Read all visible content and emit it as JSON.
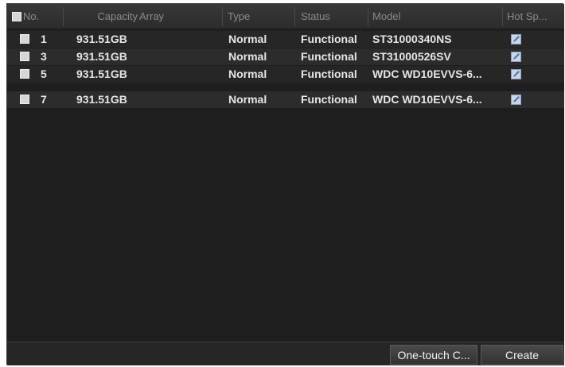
{
  "table": {
    "columns": {
      "no": "No.",
      "capacity": "Capacity",
      "array": "Array",
      "type": "Type",
      "status": "Status",
      "model": "Model",
      "hot_spare": "Hot Sp..."
    },
    "rows": [
      {
        "no": "1",
        "capacity": "931.51GB",
        "array": "",
        "type": "Normal",
        "status": "Functional",
        "model": "ST31000340NS",
        "hot_spare_icon": "edit-icon"
      },
      {
        "no": "3",
        "capacity": "931.51GB",
        "array": "",
        "type": "Normal",
        "status": "Functional",
        "model": "ST31000526SV",
        "hot_spare_icon": "edit-icon"
      },
      {
        "no": "5",
        "capacity": "931.51GB",
        "array": "",
        "type": "Normal",
        "status": "Functional",
        "model": "WDC WD10EVVS-6...",
        "hot_spare_icon": "edit-icon"
      },
      {
        "no": "7",
        "capacity": "931.51GB",
        "array": "",
        "type": "Normal",
        "status": "Functional",
        "model": "WDC WD10EVVS-6...",
        "hot_spare_icon": "edit-icon"
      }
    ]
  },
  "footer": {
    "one_touch_label": "One-touch C...",
    "create_label": "Create"
  }
}
